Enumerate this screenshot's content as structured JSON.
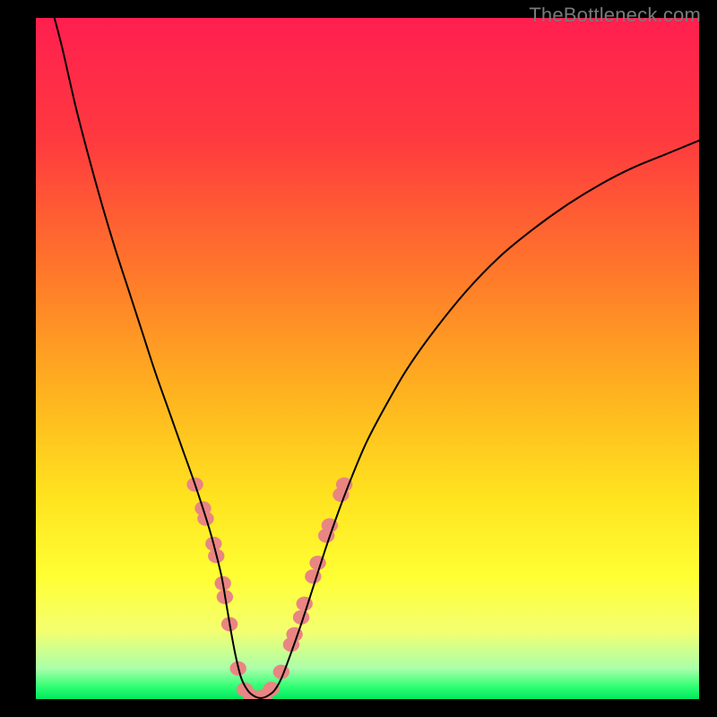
{
  "watermark": "TheBottleneck.com",
  "chart_data": {
    "type": "line",
    "title": "",
    "xlabel": "",
    "ylabel": "",
    "xlim": [
      0,
      100
    ],
    "ylim": [
      0,
      100
    ],
    "grid": false,
    "legend": false,
    "gradient_stops": [
      {
        "offset": 0.0,
        "color": "#ff1f4f"
      },
      {
        "offset": 0.18,
        "color": "#ff3a3f"
      },
      {
        "offset": 0.38,
        "color": "#ff7a2a"
      },
      {
        "offset": 0.55,
        "color": "#ffb21f"
      },
      {
        "offset": 0.7,
        "color": "#ffe21f"
      },
      {
        "offset": 0.82,
        "color": "#ffff33"
      },
      {
        "offset": 0.9,
        "color": "#f4ff70"
      },
      {
        "offset": 0.955,
        "color": "#aaffaa"
      },
      {
        "offset": 0.982,
        "color": "#2fff73"
      },
      {
        "offset": 1.0,
        "color": "#00e85e"
      }
    ],
    "series": [
      {
        "name": "bottleneck-curve",
        "color": "#000000",
        "stroke_width": 2,
        "x": [
          2.8,
          4,
          6,
          8,
          10,
          12,
          14,
          16,
          18,
          20,
          22,
          24,
          26,
          27,
          28,
          28.8,
          29.5,
          30.2,
          31,
          32,
          33,
          34,
          35,
          36,
          37,
          38,
          40,
          42,
          44,
          46,
          48,
          50,
          53,
          56,
          60,
          65,
          70,
          75,
          80,
          85,
          90,
          95,
          100
        ],
        "y": [
          100,
          95.5,
          87,
          79.5,
          72.5,
          66,
          60,
          54,
          48,
          42.5,
          37,
          31.5,
          25.5,
          22,
          18,
          13.5,
          9.5,
          6,
          3,
          1.2,
          0.4,
          0.15,
          0.5,
          1.3,
          3,
          5.5,
          11,
          17,
          23,
          28.5,
          33.5,
          38,
          43.5,
          48.5,
          54,
          60,
          65,
          69,
          72.5,
          75.5,
          78,
          80,
          82
        ]
      }
    ],
    "markers": {
      "name": "highlight-dots",
      "color": "#e98583",
      "radius": 8,
      "points": [
        {
          "x": 24.0,
          "y": 31.5
        },
        {
          "x": 25.2,
          "y": 28.0
        },
        {
          "x": 25.6,
          "y": 26.5
        },
        {
          "x": 26.8,
          "y": 22.8
        },
        {
          "x": 27.2,
          "y": 21.0
        },
        {
          "x": 28.2,
          "y": 17.0
        },
        {
          "x": 28.5,
          "y": 15.0
        },
        {
          "x": 29.2,
          "y": 11.0
        },
        {
          "x": 30.5,
          "y": 4.5
        },
        {
          "x": 31.5,
          "y": 1.4
        },
        {
          "x": 32.5,
          "y": 0.4
        },
        {
          "x": 33.5,
          "y": 0.2
        },
        {
          "x": 34.5,
          "y": 0.5
        },
        {
          "x": 35.5,
          "y": 1.5
        },
        {
          "x": 37.0,
          "y": 4.0
        },
        {
          "x": 38.5,
          "y": 8.0
        },
        {
          "x": 39.0,
          "y": 9.5
        },
        {
          "x": 40.0,
          "y": 12.0
        },
        {
          "x": 40.5,
          "y": 14.0
        },
        {
          "x": 41.8,
          "y": 18.0
        },
        {
          "x": 42.5,
          "y": 20.0
        },
        {
          "x": 43.8,
          "y": 24.0
        },
        {
          "x": 44.3,
          "y": 25.5
        },
        {
          "x": 46.0,
          "y": 30.0
        },
        {
          "x": 46.5,
          "y": 31.5
        }
      ]
    }
  }
}
